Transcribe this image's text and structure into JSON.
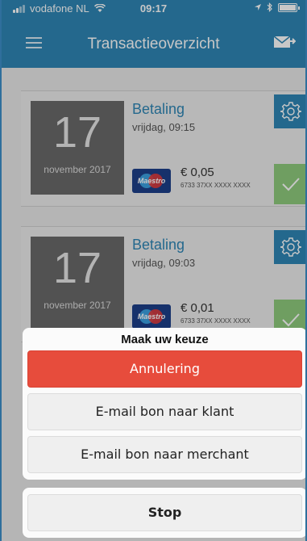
{
  "status_bar": {
    "carrier": "vodafone NL",
    "time": "09:17",
    "icons": [
      "signal-icon",
      "wifi-icon",
      "location-icon",
      "bluetooth-icon",
      "battery-icon"
    ]
  },
  "nav": {
    "title": "Transactieoverzicht",
    "menu_icon": "hamburger-menu-icon",
    "mail_icon": "send-mail-icon"
  },
  "transactions": [
    {
      "day": "17",
      "month_year": "november 2017",
      "type": "Betaling",
      "when": "vrijdag, 09:15",
      "card_brand": "Maestro",
      "amount": "€ 0,05",
      "card_number": "6733 37XX XXXX XXXX"
    },
    {
      "day": "17",
      "month_year": "november 2017",
      "type": "Betaling",
      "when": "vrijdag, 09:03",
      "card_brand": "Maestro",
      "amount": "€ 0,01",
      "card_number": "6733 37XX XXXX XXXX"
    }
  ],
  "action_sheet": {
    "title": "Maak uw keuze",
    "options": [
      {
        "label": "Annulering"
      },
      {
        "label": "E-mail bon naar klant"
      },
      {
        "label": "E-mail bon naar merchant"
      }
    ],
    "cancel_label": "Stop"
  },
  "colors": {
    "primary": "#2f86b5",
    "danger": "#e74c3c",
    "success": "#8fcb7d",
    "date_box": "#6a6a6a"
  }
}
